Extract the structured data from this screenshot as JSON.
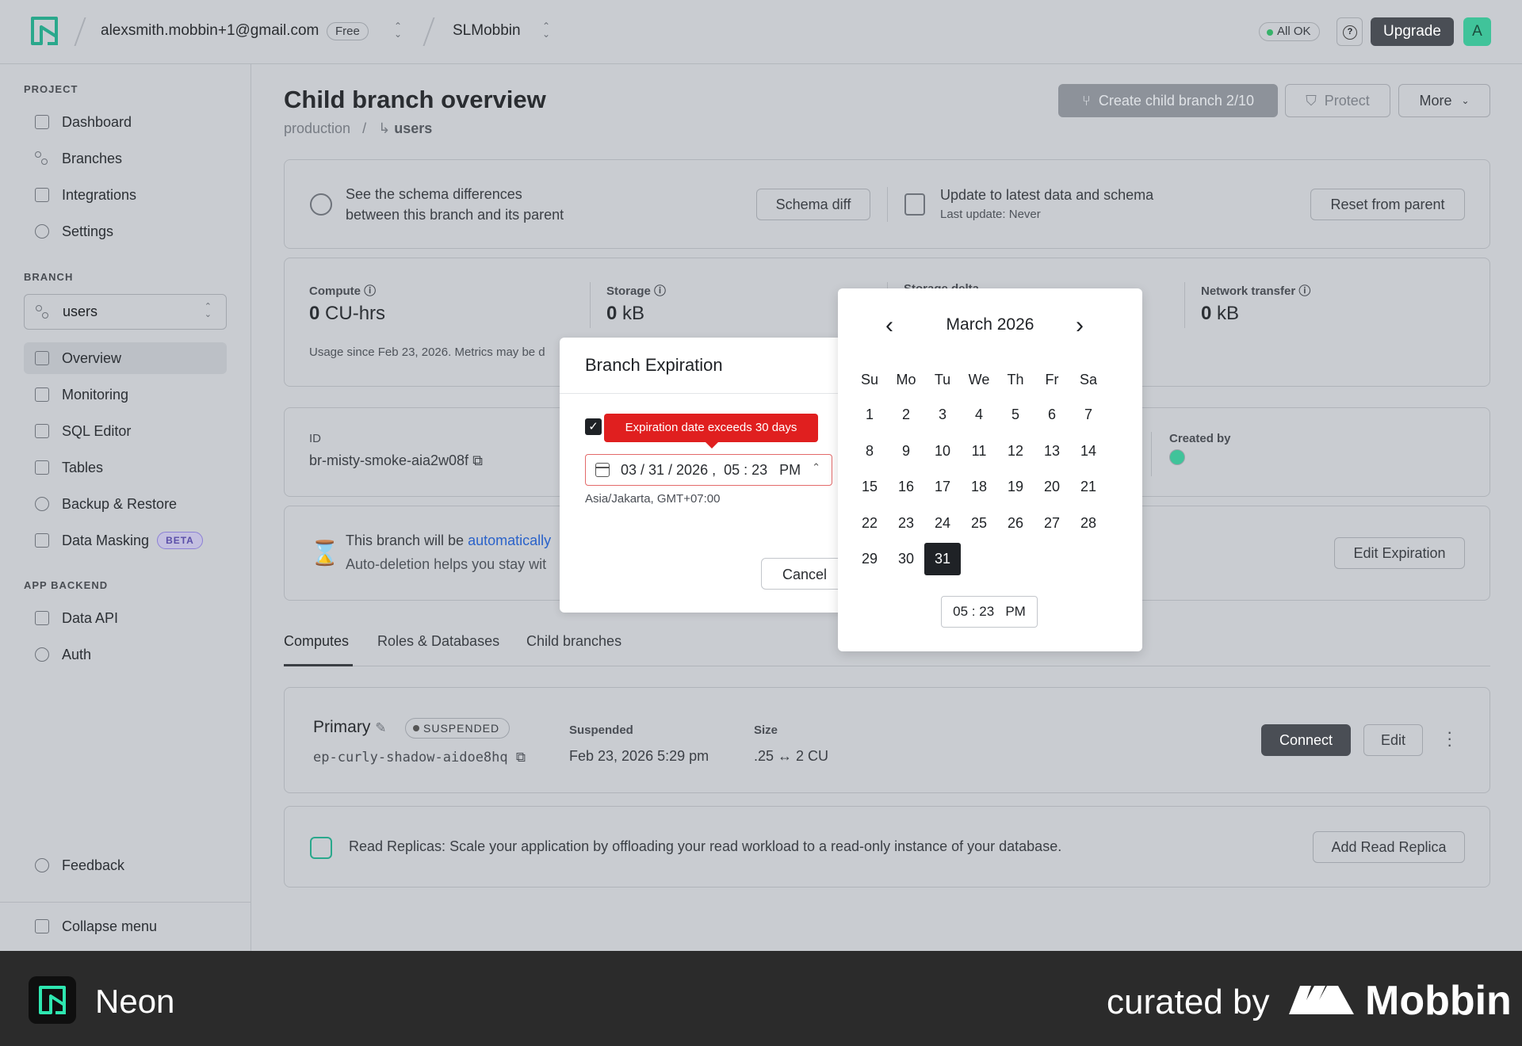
{
  "topbar": {
    "account": "alexsmith.mobbin+1@gmail.com",
    "plan": "Free",
    "project": "SLMobbin",
    "status": "All OK",
    "upgrade": "Upgrade",
    "avatar": "A"
  },
  "sidebar": {
    "project_label": "PROJECT",
    "project_items": [
      "Dashboard",
      "Branches",
      "Integrations",
      "Settings"
    ],
    "branch_label": "BRANCH",
    "branch_select": "users",
    "branch_items": [
      "Overview",
      "Monitoring",
      "SQL Editor",
      "Tables",
      "Backup & Restore",
      "Data Masking"
    ],
    "beta": "BETA",
    "app_backend_label": "APP BACKEND",
    "app_items": [
      "Data API",
      "Auth"
    ],
    "feedback": "Feedback",
    "collapse": "Collapse menu"
  },
  "page": {
    "title": "Child branch overview",
    "breadcrumb_parent": "production",
    "breadcrumb_sep": "/",
    "breadcrumb_current": "users",
    "create_child": "Create child branch 2/10",
    "protect": "Protect",
    "more": "More"
  },
  "schema": {
    "text1": "See the schema differences",
    "text2": "between this branch and its parent",
    "diff_btn": "Schema diff",
    "update_title": "Update to latest data and schema",
    "update_sub": "Last update: Never",
    "reset_btn": "Reset from parent"
  },
  "metrics": {
    "compute_label": "Compute",
    "compute_value": "0",
    "compute_unit": "CU-hrs",
    "storage_label": "Storage",
    "storage_value": "0",
    "storage_unit": "kB",
    "delta_label": "Storage delta",
    "network_label": "Network transfer",
    "network_value": "0",
    "network_unit": "kB",
    "usage_note": "Usage since Feb 23, 2026. Metrics may be d"
  },
  "info": {
    "id_label": "ID",
    "id_value": "br-misty-smoke-aia2w08f",
    "created_by_label": "Created by"
  },
  "expiration": {
    "text_prefix": "This branch will be ",
    "text_link": "automatically",
    "text2": "Auto-deletion helps you stay wit",
    "edit_btn": "Edit Expiration"
  },
  "tabs": [
    "Computes",
    "Roles & Databases",
    "Child branches"
  ],
  "compute_card": {
    "name": "Primary",
    "state": "SUSPENDED",
    "endpoint": "ep-curly-shadow-aidoe8hq",
    "suspended_label": "Suspended",
    "suspended_value": "Feb 23, 2026 5:29 pm",
    "size_label": "Size",
    "size_value": ".25 ↔ 2 CU",
    "connect": "Connect",
    "edit": "Edit"
  },
  "replica": {
    "text": "Read Replicas: Scale your application by offloading your read workload to a read-only instance of your database.",
    "btn": "Add Read Replica"
  },
  "dialog": {
    "title": "Branch Expiration",
    "tooltip": "Expiration date exceeds 30 days",
    "date_value": "03 / 31 / 2026 ,  05 : 23   PM",
    "timezone": "Asia/Jakarta, GMT+07:00",
    "cancel": "Cancel"
  },
  "calendar": {
    "month": "March 2026",
    "weekdays": [
      "Su",
      "Mo",
      "Tu",
      "We",
      "Th",
      "Fr",
      "Sa"
    ],
    "days": [
      "1",
      "2",
      "3",
      "4",
      "5",
      "6",
      "7",
      "8",
      "9",
      "10",
      "11",
      "12",
      "13",
      "14",
      "15",
      "16",
      "17",
      "18",
      "19",
      "20",
      "21",
      "22",
      "23",
      "24",
      "25",
      "26",
      "27",
      "28",
      "29",
      "30",
      "31"
    ],
    "selected": "31",
    "time": "05 : 23   PM"
  },
  "footer": {
    "brand": "Neon",
    "curated": "curated by",
    "mobbin": "Mobbin"
  }
}
